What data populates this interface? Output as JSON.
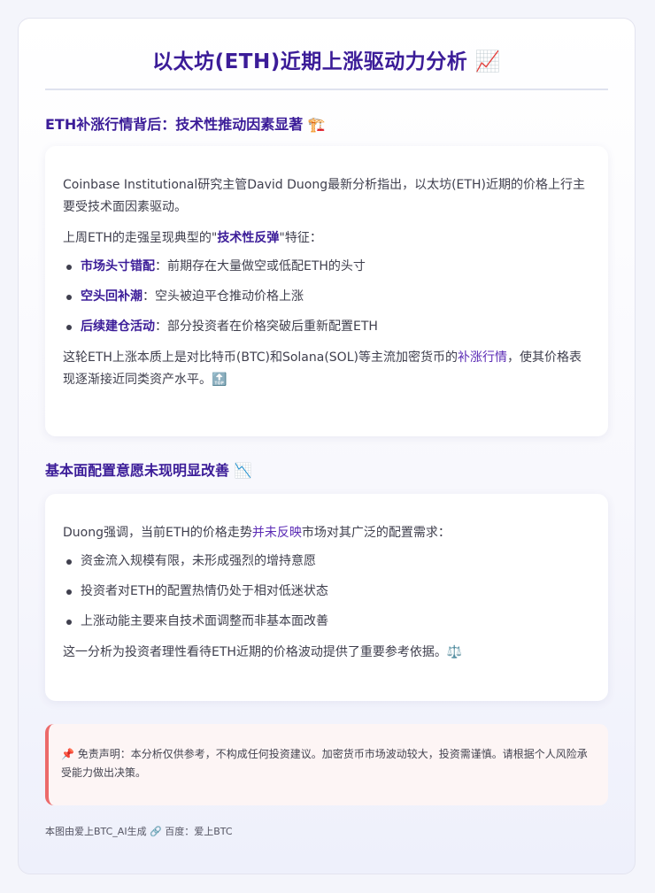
{
  "title": "以太坊(ETH)近期上涨驱动力分析 📈",
  "section1": {
    "heading": "ETH补涨行情背后：技术性推动因素显著 🏗️",
    "intro": "Coinbase Institutional研究主管David Duong最新分析指出，以太坊(ETH)近期的价格上行主要受技术面因素驱动。",
    "lead_before": "上周ETH的走强呈现典型的\"",
    "lead_keyword": "技术性反弹",
    "lead_after": "\"特征：",
    "points": [
      {
        "keyword": "市场头寸错配",
        "text": "：前期存在大量做空或低配ETH的头寸"
      },
      {
        "keyword": "空头回补潮",
        "text": "：空头被迫平仓推动价格上涨"
      },
      {
        "keyword": "后续建仓活动",
        "text": "：部分投资者在价格突破后重新配置ETH"
      }
    ],
    "conclusion_before": "这轮ETH上涨本质上是对比特币(BTC)和Solana(SOL)等主流加密货币的",
    "conclusion_highlight": "补涨行情",
    "conclusion_after": "，使其价格表现逐渐接近同类资产水平。🔝"
  },
  "section2": {
    "heading": "基本面配置意愿未现明显改善 📉",
    "intro_before": "Duong强调，当前ETH的价格走势",
    "intro_highlight": "并未反映",
    "intro_after": "市场对其广泛的配置需求：",
    "points": [
      "资金流入规模有限，未形成强烈的增持意愿",
      "投资者对ETH的配置热情仍处于相对低迷状态",
      "上涨动能主要来自技术面调整而非基本面改善"
    ],
    "conclusion": "这一分析为投资者理性看待ETH近期的价格波动提供了重要参考依据。⚖️"
  },
  "disclaimer": "📌 免责声明：本分析仅供参考，不构成任何投资建议。加密货币市场波动较大，投资需谨慎。请根据个人风险承受能力做出决策。",
  "footer": "本图由爱上BTC_AI生成 🔗 百度：爱上BTC",
  "colors": {
    "accent": "#3b1c98",
    "highlight": "#5b2bb5",
    "disclaimer_border": "#ec6a6a",
    "disclaimer_bg": "#fdf5f5"
  }
}
